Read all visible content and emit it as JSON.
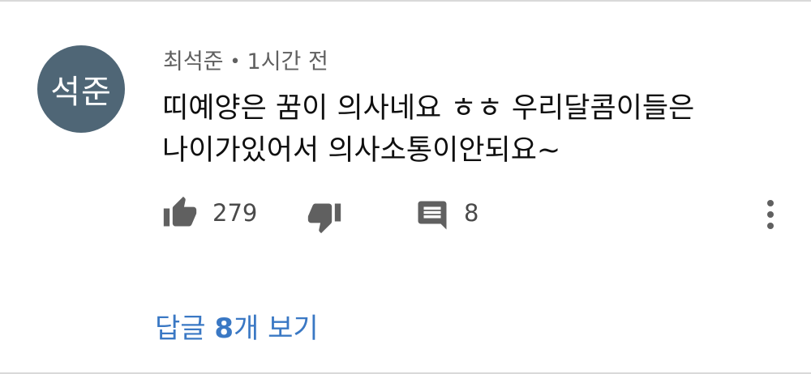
{
  "comment": {
    "avatar_text": "석준",
    "author": "최석준",
    "separator": "•",
    "time": "1시간 전",
    "text_line1": "띠예양은 꿈이 의사네요 ㅎㅎ 우리달콤이들은",
    "text_line2": "나이가있어서 의사소통이안되요~",
    "likes": "279",
    "reply_count": "8",
    "icons": [
      "thumbs-up-icon",
      "thumbs-down-icon",
      "comment-icon",
      "more-vert-icon"
    ],
    "colors": {
      "avatar_bg": "#4f6676",
      "link": "#3a78c4",
      "icon": "#606060"
    }
  },
  "replies": {
    "prefix": "답글 ",
    "count": "8",
    "suffix": "개 보기"
  }
}
